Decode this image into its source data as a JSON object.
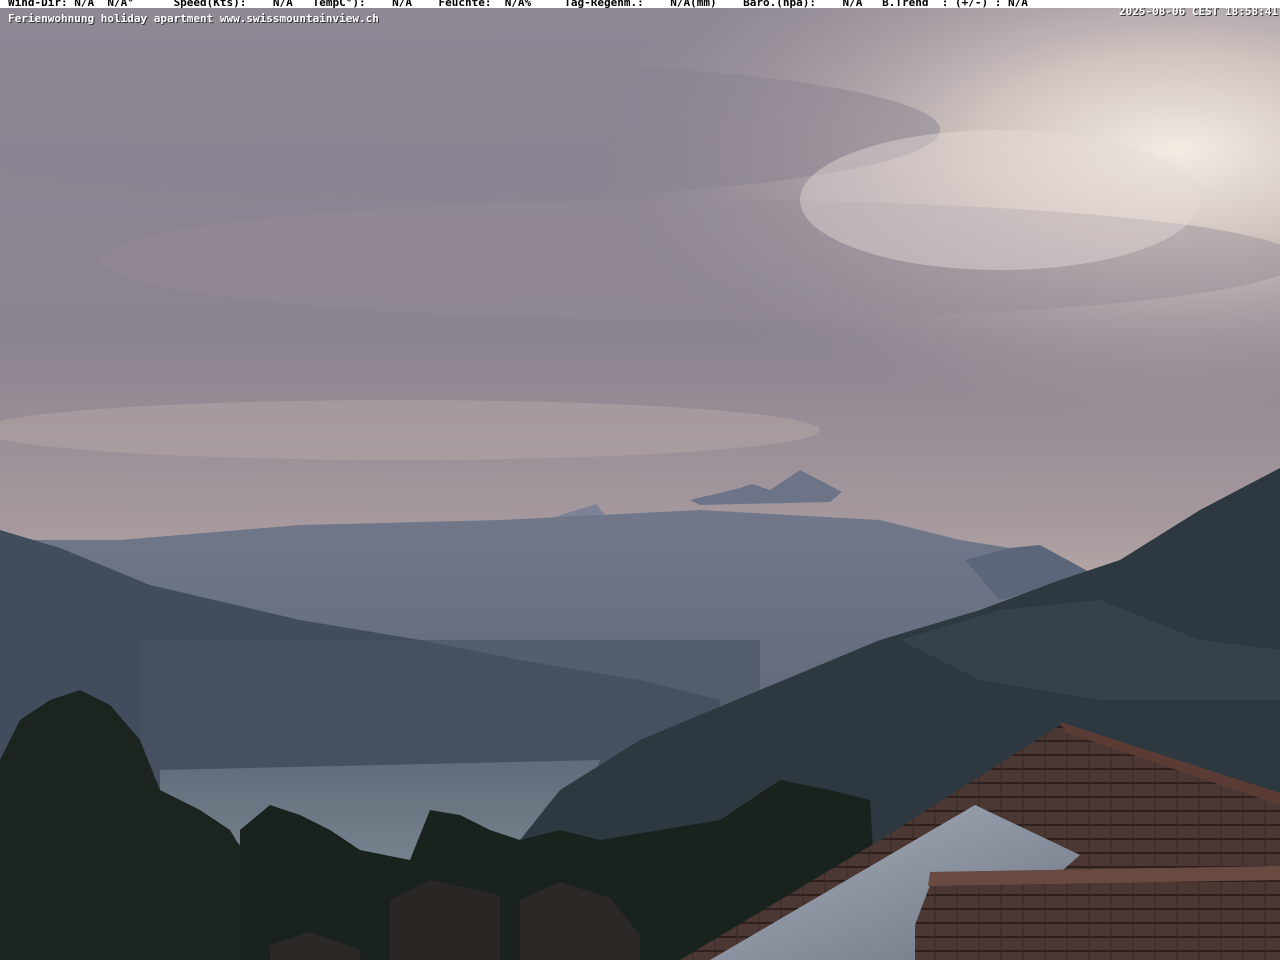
{
  "overlay": {
    "weather_line": "Wind-Dir: N/A  N/A°      Speed(Kts):    N/A   TempC°):    N/A    Feuchte:  N/A%     Tag-Regenm.:    N/A(mm)    Baro.(hpa):    N/A   B.Trend  : (+/-) : N/A",
    "timestamp": "2025-08-06 CEST 18:58:41",
    "caption": "Ferienwohnung holiday apartment www.swissmountainview.ch"
  },
  "scene": {
    "description_colors": {
      "sky_top": "#8e8794",
      "sky_glow": "#efe6dc",
      "mountains_far": "#5d6a80",
      "mountains_near": "#2f3a44",
      "lake": "#6c7a86",
      "trees": "#1c2420",
      "roof": "#4a3632",
      "solar_panel": "#8f98a6"
    }
  }
}
